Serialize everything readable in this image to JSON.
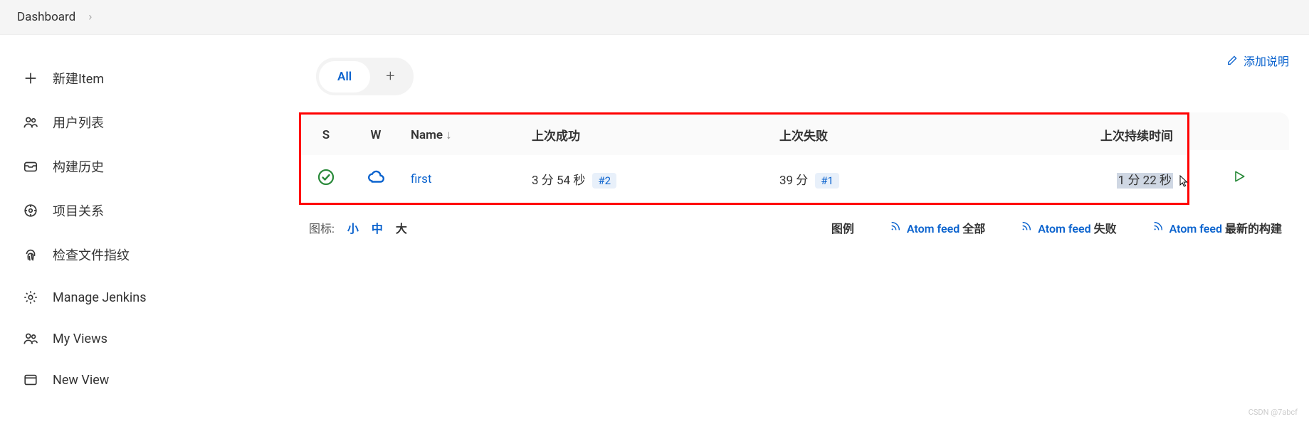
{
  "breadcrumb": {
    "dashboard": "Dashboard"
  },
  "sidebar": {
    "items": [
      {
        "label": "新建Item",
        "icon": "plus"
      },
      {
        "label": "用户列表",
        "icon": "people"
      },
      {
        "label": "构建历史",
        "icon": "inbox"
      },
      {
        "label": "项目关系",
        "icon": "target"
      },
      {
        "label": "检查文件指纹",
        "icon": "fingerprint"
      },
      {
        "label": "Manage Jenkins",
        "icon": "gear"
      },
      {
        "label": "My Views",
        "icon": "people"
      },
      {
        "label": "New View",
        "icon": "window"
      }
    ]
  },
  "add_description": "添加说明",
  "tabs": {
    "all": "All"
  },
  "table": {
    "headers": {
      "s": "S",
      "w": "W",
      "name": "Name",
      "sort": "↓",
      "last_success": "上次成功",
      "last_failure": "上次失败",
      "last_duration": "上次持续时间"
    },
    "rows": [
      {
        "name": "first",
        "last_success": "3 分 54 秒",
        "last_success_build": "#2",
        "last_failure": "39 分",
        "last_failure_build": "#1",
        "last_duration": "1 分 22 秒"
      }
    ]
  },
  "footer": {
    "icon_label": "图标:",
    "sizes": {
      "small": "小",
      "medium": "中",
      "large": "大"
    },
    "legend": "图例",
    "feed_all_prefix": "Atom feed ",
    "feed_all_suffix": "全部",
    "feed_fail_prefix": "Atom feed ",
    "feed_fail_suffix": "失败",
    "feed_latest_prefix": "Atom feed ",
    "feed_latest_suffix": "最新的构建"
  },
  "watermark": "CSDN @7abcf"
}
